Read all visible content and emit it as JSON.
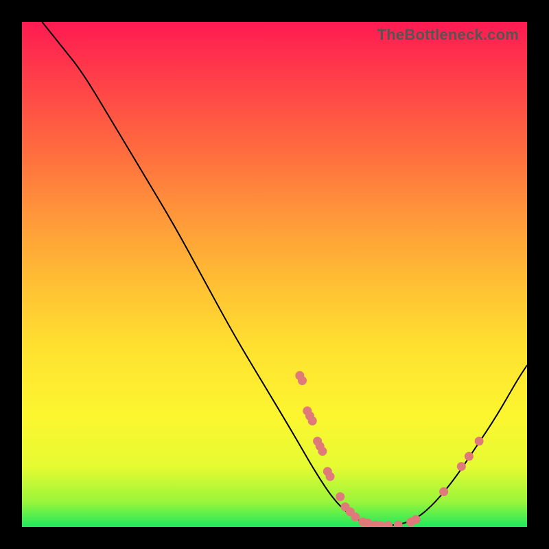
{
  "watermark": "TheBottleneck.com",
  "chart_data": {
    "type": "line",
    "title": "",
    "xlabel": "",
    "ylabel": "",
    "xlim": [
      0,
      100
    ],
    "ylim": [
      0,
      100
    ],
    "grid": false,
    "legend": false,
    "curve": [
      {
        "x": 4,
        "y": 100
      },
      {
        "x": 8,
        "y": 95
      },
      {
        "x": 12,
        "y": 90
      },
      {
        "x": 18,
        "y": 80
      },
      {
        "x": 24,
        "y": 70
      },
      {
        "x": 30,
        "y": 60
      },
      {
        "x": 36,
        "y": 49
      },
      {
        "x": 42,
        "y": 38
      },
      {
        "x": 48,
        "y": 28
      },
      {
        "x": 54,
        "y": 18
      },
      {
        "x": 58,
        "y": 11
      },
      {
        "x": 62,
        "y": 5
      },
      {
        "x": 66,
        "y": 1.5
      },
      {
        "x": 70,
        "y": 0.3
      },
      {
        "x": 74,
        "y": 0.3
      },
      {
        "x": 78,
        "y": 1.5
      },
      {
        "x": 82,
        "y": 5
      },
      {
        "x": 86,
        "y": 10
      },
      {
        "x": 90,
        "y": 16
      },
      {
        "x": 94,
        "y": 22
      },
      {
        "x": 98,
        "y": 29
      },
      {
        "x": 100,
        "y": 32
      }
    ],
    "points": [
      {
        "x": 55,
        "y": 30
      },
      {
        "x": 55.5,
        "y": 29
      },
      {
        "x": 56.5,
        "y": 23
      },
      {
        "x": 57,
        "y": 22
      },
      {
        "x": 57.5,
        "y": 21
      },
      {
        "x": 58.5,
        "y": 17
      },
      {
        "x": 59,
        "y": 16
      },
      {
        "x": 59.5,
        "y": 15
      },
      {
        "x": 60.5,
        "y": 11
      },
      {
        "x": 61,
        "y": 10
      },
      {
        "x": 63,
        "y": 6
      },
      {
        "x": 64,
        "y": 4
      },
      {
        "x": 65,
        "y": 3
      },
      {
        "x": 66,
        "y": 2
      },
      {
        "x": 67.5,
        "y": 1
      },
      {
        "x": 68.5,
        "y": 0.8
      },
      {
        "x": 70,
        "y": 0.4
      },
      {
        "x": 71,
        "y": 0.3
      },
      {
        "x": 72.5,
        "y": 0.3
      },
      {
        "x": 74.5,
        "y": 0.4
      },
      {
        "x": 77,
        "y": 1
      },
      {
        "x": 78,
        "y": 1.5
      },
      {
        "x": 83.5,
        "y": 7
      },
      {
        "x": 87,
        "y": 12
      },
      {
        "x": 88.5,
        "y": 14
      },
      {
        "x": 90.5,
        "y": 17
      }
    ],
    "colors": {
      "curve": "#000000",
      "points": "#e07a7a",
      "gradient_top": "#ff1a52",
      "gradient_bottom": "#1ee85d"
    }
  }
}
